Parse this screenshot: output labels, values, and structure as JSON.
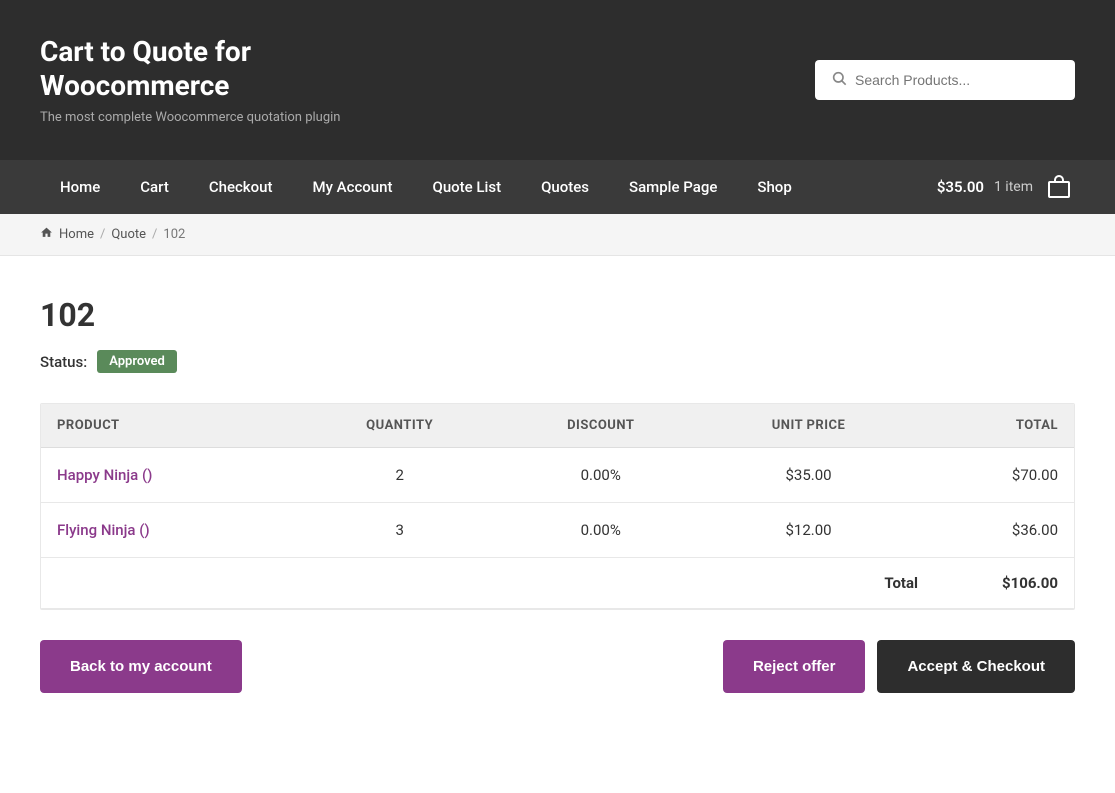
{
  "header": {
    "title": "Cart to Quote for Woocommerce",
    "tagline": "The most complete Woocommerce quotation plugin",
    "search_placeholder": "Search Products...",
    "cart_amount": "$35.00",
    "cart_count": "1 item"
  },
  "nav": {
    "links": [
      {
        "label": "Home",
        "href": "#"
      },
      {
        "label": "Cart",
        "href": "#"
      },
      {
        "label": "Checkout",
        "href": "#"
      },
      {
        "label": "My Account",
        "href": "#"
      },
      {
        "label": "Quote List",
        "href": "#"
      },
      {
        "label": "Quotes",
        "href": "#"
      },
      {
        "label": "Sample Page",
        "href": "#"
      },
      {
        "label": "Shop",
        "href": "#"
      }
    ]
  },
  "breadcrumb": {
    "items": [
      {
        "label": "Home",
        "href": "#"
      },
      {
        "label": "Quote",
        "href": "#"
      },
      {
        "label": "102",
        "href": null
      }
    ]
  },
  "quote": {
    "id": "102",
    "status_label": "Status:",
    "status": "Approved",
    "status_color": "#5a8a5a",
    "table": {
      "columns": [
        "PRODUCT",
        "QUANTITY",
        "DISCOUNT",
        "UNIT PRICE",
        "TOTAL"
      ],
      "rows": [
        {
          "product": "Happy Ninja ()",
          "quantity": "2",
          "discount": "0.00%",
          "unit_price": "$35.00",
          "total": "$70.00"
        },
        {
          "product": "Flying Ninja ()",
          "quantity": "3",
          "discount": "0.00%",
          "unit_price": "$12.00",
          "total": "$36.00"
        }
      ],
      "total_label": "Total",
      "total_value": "$106.00"
    },
    "buttons": {
      "back": "Back to my account",
      "reject": "Reject offer",
      "accept": "Accept & Checkout"
    }
  }
}
